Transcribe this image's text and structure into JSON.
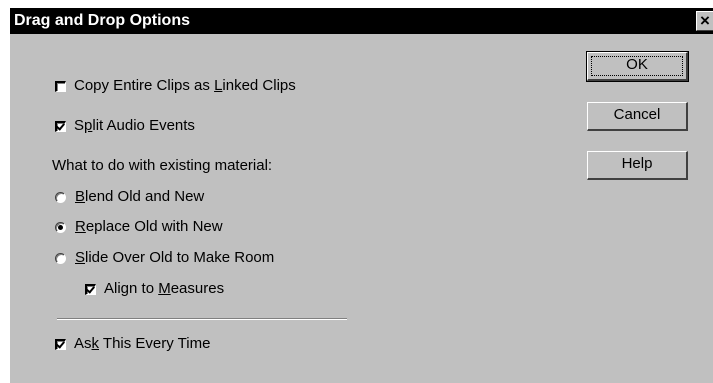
{
  "dialog": {
    "title": "Drag and Drop Options",
    "close_glyph": "×",
    "options": {
      "copy_clips": {
        "pre": "Copy Entire Clips as ",
        "mnemonic": "L",
        "post": "inked Clips",
        "checked": false
      },
      "split_audio": {
        "pre": "S",
        "mnemonic": "p",
        "post": "lit Audio Events",
        "checked": true
      },
      "existing_label": "What to do with existing material:",
      "blend": {
        "pre": "",
        "mnemonic": "B",
        "post": "lend Old and New",
        "selected": false
      },
      "replace": {
        "pre": "",
        "mnemonic": "R",
        "post": "eplace Old with New",
        "selected": true
      },
      "slide": {
        "pre": "",
        "mnemonic": "S",
        "post": "lide Over Old to Make Room",
        "selected": false
      },
      "align": {
        "pre": "Align to ",
        "mnemonic": "M",
        "post": "easures",
        "checked": true
      },
      "ask": {
        "pre": "As",
        "mnemonic": "k",
        "post": " This Every Time",
        "checked": true
      }
    },
    "buttons": {
      "ok": "OK",
      "cancel": "Cancel",
      "help": "Help"
    }
  }
}
